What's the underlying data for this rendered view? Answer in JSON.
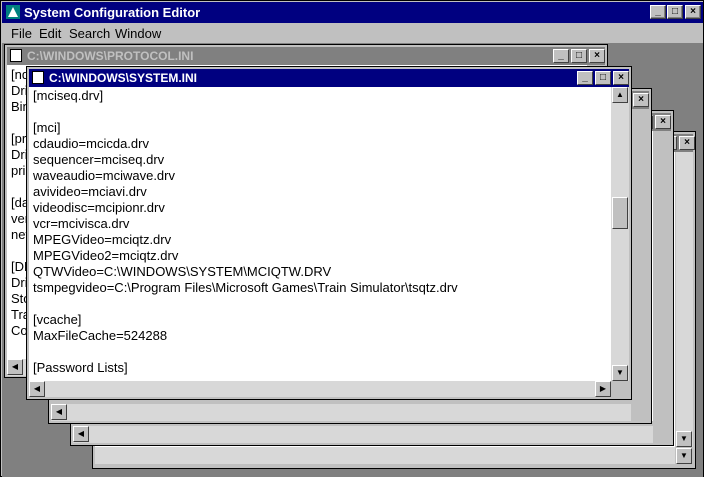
{
  "app": {
    "title": "System Configuration Editor",
    "minimize": "▁",
    "maximize": "□",
    "close": "✕"
  },
  "menu": [
    {
      "label": "File"
    },
    {
      "label": "Edit"
    },
    {
      "label": "Search"
    },
    {
      "label": "Window"
    }
  ],
  "windows": {
    "protocol": {
      "title": "C:\\WINDOWS\\PROTOCOL.INI",
      "visible_lines": "[nd\nDri\nBin\n\n[pr\nDri\npri\n\n[da\nver\nnet\n\n[DN\nDri\nSto\nTra\nCo"
    },
    "system": {
      "title": "C:\\WINDOWS\\SYSTEM.INI",
      "lines": [
        "[mciseq.drv]",
        "",
        "[mci]",
        "cdaudio=mcicda.drv",
        "sequencer=mciseq.drv",
        "waveaudio=mciwave.drv",
        "avivideo=mciavi.drv",
        "videodisc=mcipionr.drv",
        "vcr=mcivisca.drv",
        "MPEGVideo=mciqtz.drv",
        "MPEGVideo2=mciqtz.drv",
        "QTWVideo=C:\\WINDOWS\\SYSTEM\\MCIQTW.DRV",
        "tsmpegvideo=C:\\Program Files\\Microsoft Games\\Train Simulator\\tsqtz.drv",
        "",
        "[vcache]",
        "MaxFileCache=524288",
        "",
        "[Password Lists]"
      ]
    }
  },
  "scroll": {
    "up_arrow": "▲",
    "down_arrow": "▼",
    "left_arrow": "◀",
    "right_arrow": "▶"
  }
}
